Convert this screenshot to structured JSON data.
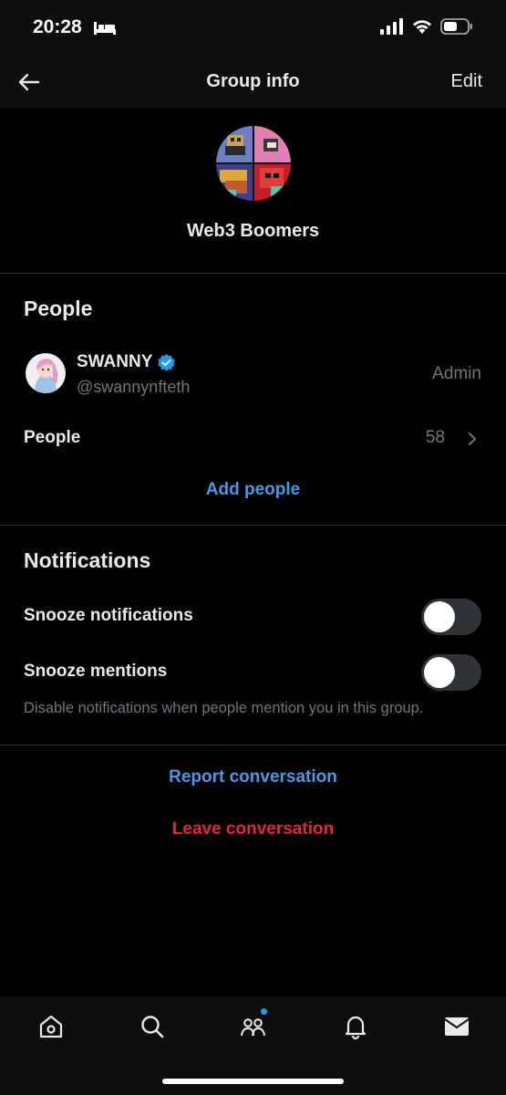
{
  "status_bar": {
    "time": "20:28",
    "icons": [
      "bed-icon",
      "cellular-signal-icon",
      "wifi-icon",
      "battery-icon"
    ]
  },
  "header": {
    "title": "Group info",
    "edit_label": "Edit",
    "back_icon": "back-arrow-icon"
  },
  "group": {
    "name": "Web3 Boomers"
  },
  "people_section": {
    "title": "People",
    "member": {
      "name": "SWANNY",
      "handle": "@swannynfteth",
      "role": "Admin",
      "verified": true
    },
    "people_row": {
      "label": "People",
      "count": "58"
    },
    "add_people_label": "Add people"
  },
  "notifications_section": {
    "title": "Notifications",
    "snooze_notifications": {
      "label": "Snooze notifications",
      "on": false
    },
    "snooze_mentions": {
      "label": "Snooze mentions",
      "on": false
    },
    "helper_text": "Disable notifications when people mention you in this group."
  },
  "actions": {
    "report_label": "Report conversation",
    "leave_label": "Leave conversation"
  },
  "tab_bar": {
    "items": [
      "home-icon",
      "search-icon",
      "communities-icon",
      "notifications-bell-icon",
      "messages-envelope-icon"
    ],
    "active_dot_on": "communities-icon"
  },
  "colors": {
    "background": "#000000",
    "link_blue": "#4a99e9",
    "danger_red": "#e0283a",
    "verified_blue": "#1d9bf0",
    "muted_text": "#71767b"
  }
}
